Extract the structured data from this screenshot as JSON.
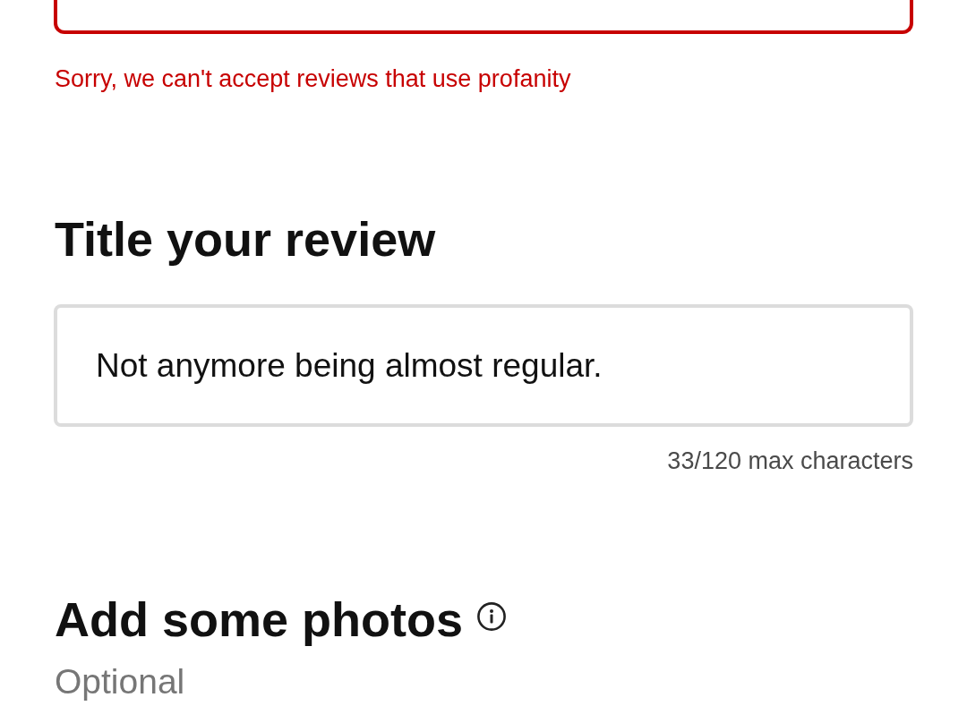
{
  "review_field": {
    "error": true
  },
  "error_message": "Sorry, we can't accept reviews that use profanity",
  "title_section": {
    "heading": "Title your review",
    "input": {
      "value": "Not anymore being almost regular."
    },
    "counter": "33/120 max characters"
  },
  "photos_section": {
    "heading": "Add some photos",
    "note": "Optional"
  }
}
